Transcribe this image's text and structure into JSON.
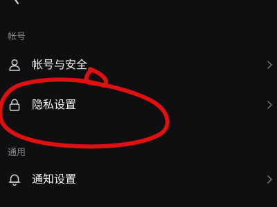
{
  "header": {
    "title": "",
    "back_icon": "chevron-left-icon"
  },
  "sections": [
    {
      "label": "帐号",
      "items": [
        {
          "label": "帐号与安全",
          "icon": "user-icon"
        },
        {
          "label": "隐私设置",
          "icon": "lock-icon"
        }
      ]
    },
    {
      "label": "通用",
      "items": [
        {
          "label": "通知设置",
          "icon": "bell-icon"
        }
      ]
    }
  ],
  "annotation": {
    "color": "#e01010",
    "target": "隐私设置"
  },
  "colors": {
    "background": "#0f0f12",
    "text": "#f2f2f4",
    "muted": "#86868e"
  }
}
